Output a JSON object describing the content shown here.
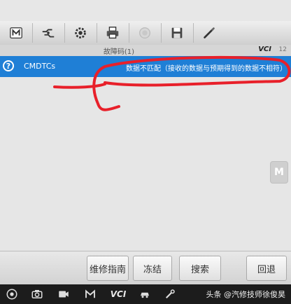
{
  "toolbar": {
    "icons": [
      "home-icon",
      "vehicle-swap-icon",
      "settings-icon",
      "print-icon",
      "help-icon",
      "save-icon",
      "edit-icon"
    ]
  },
  "titlebar": {
    "title": "故障码(1)",
    "vci": "VCI",
    "battery": "12"
  },
  "dtc_list": {
    "rows": [
      {
        "icon": "?",
        "name": "CMDTCs",
        "status": "数据不匹配（接收的数据与预期得到的数据不相符）"
      }
    ]
  },
  "side_button": {
    "label": "M"
  },
  "bottom_buttons": {
    "repair_guide": "维修指南",
    "freeze": "冻结",
    "search": "搜索",
    "back": "回退"
  },
  "navbar": {
    "watermark": "头条 @汽修技师徐俊昊",
    "vci": "VCI"
  },
  "colors": {
    "row_highlight": "#1f7fd6",
    "annotation": "#e8202a"
  }
}
